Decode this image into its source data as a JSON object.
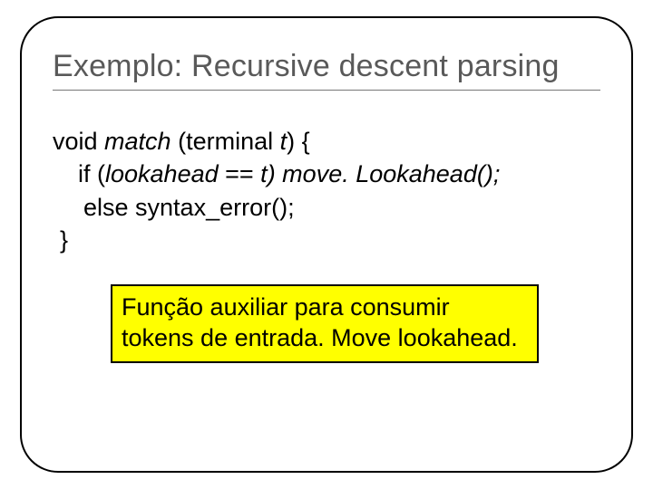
{
  "title": "Exemplo: Recursive descent parsing",
  "code": {
    "l1a": "void ",
    "l1b": "match",
    "l1c": " (terminal ",
    "l1d": "t",
    "l1e": ") {",
    "l2a": "if (",
    "l2b": "lookahead",
    "l2c": " == ",
    "l2d": "t",
    "l2e": ") move. Lookahead()",
    "l2f": ";",
    "l3": "else syntax_error();",
    "l4": "}"
  },
  "callout": "Função auxiliar para consumir tokens de entrada.  Move lookahead."
}
